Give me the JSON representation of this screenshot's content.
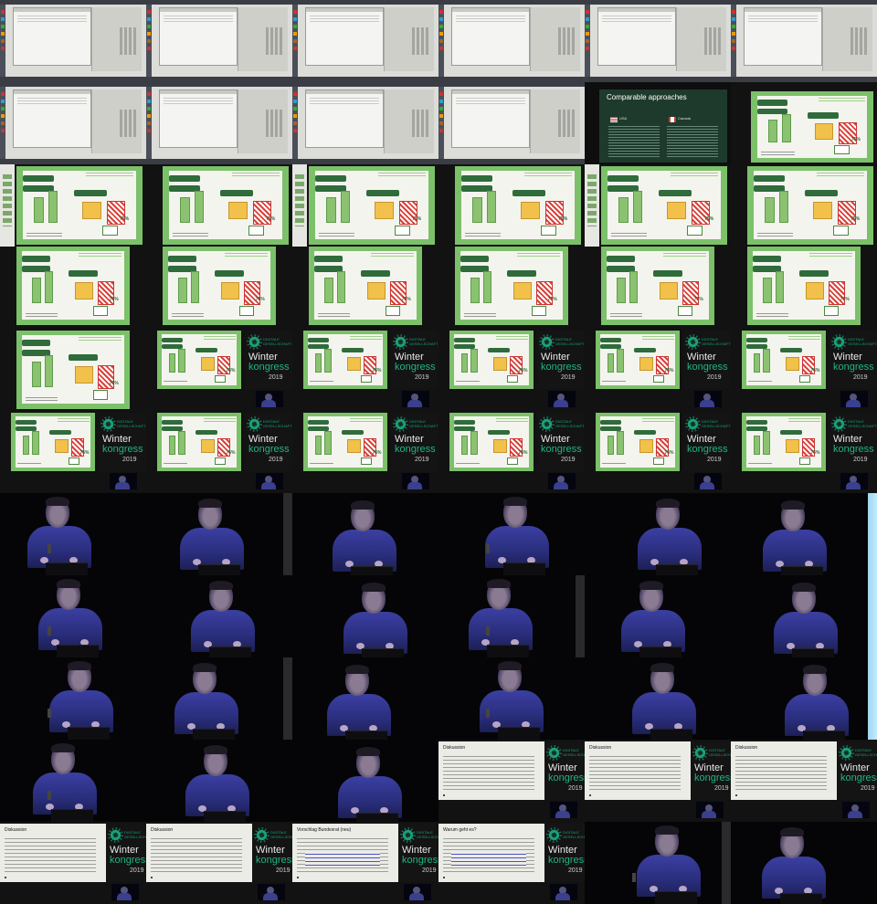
{
  "slides": {
    "comparable": {
      "title": "Comparable approaches",
      "country_left": "USA",
      "country_right": "Canada"
    },
    "discussion_title": "Diskussion",
    "vorschlag_title": "Vorschlag Bundesrat (neu)",
    "warum_title": "Warum geht es?"
  },
  "branding": {
    "org": "DIGITALE\nGESELLSCHAFT",
    "word1": "Winter",
    "word2": "kongress",
    "year": "2019"
  },
  "infographic": {
    "pct_label": "75%"
  },
  "colors": {
    "slide_green": "#7cc06a",
    "dark_green": "#2f6b3b",
    "brand_teal": "#1fb487",
    "shirt_blue": "#3b3fa2"
  }
}
